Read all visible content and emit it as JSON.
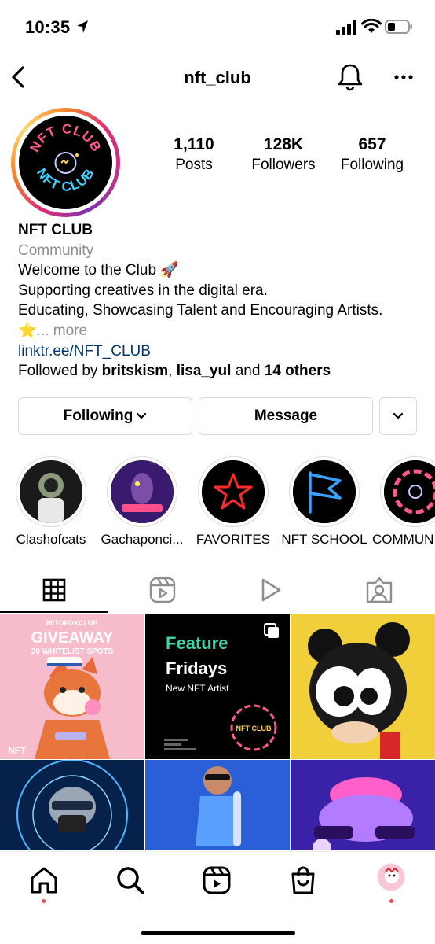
{
  "status_bar": {
    "time": "10:35"
  },
  "header": {
    "username": "nft_club"
  },
  "profile": {
    "avatar_ring_text_top": "NFT CLUB",
    "avatar_ring_text_bottom": "NFT CLUB",
    "stats": [
      {
        "value": "1,110",
        "label": "Posts"
      },
      {
        "value": "128K",
        "label": "Followers"
      },
      {
        "value": "657",
        "label": "Following"
      }
    ],
    "name": "NFT CLUB",
    "category": "Community",
    "bio_line1": "Welcome to the Club 🚀",
    "bio_line2": "Supporting creatives in the digital era.",
    "bio_line3": "Educating, Showcasing Talent and Encouraging Artists.",
    "bio_line4_emoji": "⭐️",
    "bio_more": "... more",
    "link": "linktr.ee/NFT_CLUB",
    "followed_by_prefix": "Followed by ",
    "followed_by_user1": "britskism",
    "followed_by_sep": ", ",
    "followed_by_user2": "lisa_yul",
    "followed_by_and": " and ",
    "followed_by_others": "14 others"
  },
  "buttons": {
    "following": "Following",
    "message": "Message"
  },
  "highlights": [
    {
      "label": "Clashofcats"
    },
    {
      "label": "Gachaponci..."
    },
    {
      "label": "FAVORITES"
    },
    {
      "label": "NFT SCHOOL"
    },
    {
      "label": "COMMUNI"
    }
  ],
  "grid": {
    "post1": {
      "header": "MITOFOXCLUB",
      "title": "GIVEAWAY",
      "subtitle": "20 WHITELIST SPOTS",
      "tag": "NFT"
    },
    "post2": {
      "title1": "Feature",
      "title2": "Fridays",
      "subtitle": "New NFT Artist",
      "badge": "NFT CLUB"
    }
  },
  "colors": {
    "link": "#00376b",
    "muted": "#8e8e8e",
    "border": "#dbdbdb",
    "notification": "#ed4956"
  }
}
